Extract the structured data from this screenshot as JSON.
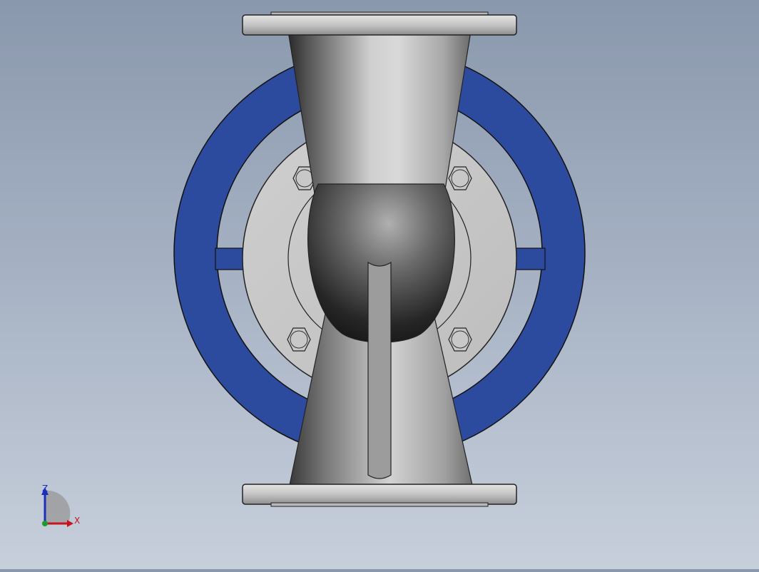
{
  "viewport": {
    "model": "valve-assembly",
    "colors": {
      "background_top": "#8a98ad",
      "background_bottom": "#c7cfdb",
      "handwheel": "#2d4b9e",
      "metal_light": "#d6d6d6",
      "metal_dark": "#1e1e1e",
      "outline": "#1a1a1a"
    }
  },
  "triad": {
    "z_label": "Z",
    "x_label": "X",
    "z_color": "#1b2fbf",
    "x_color": "#c8141e",
    "y_color": "#1c9c2c"
  }
}
